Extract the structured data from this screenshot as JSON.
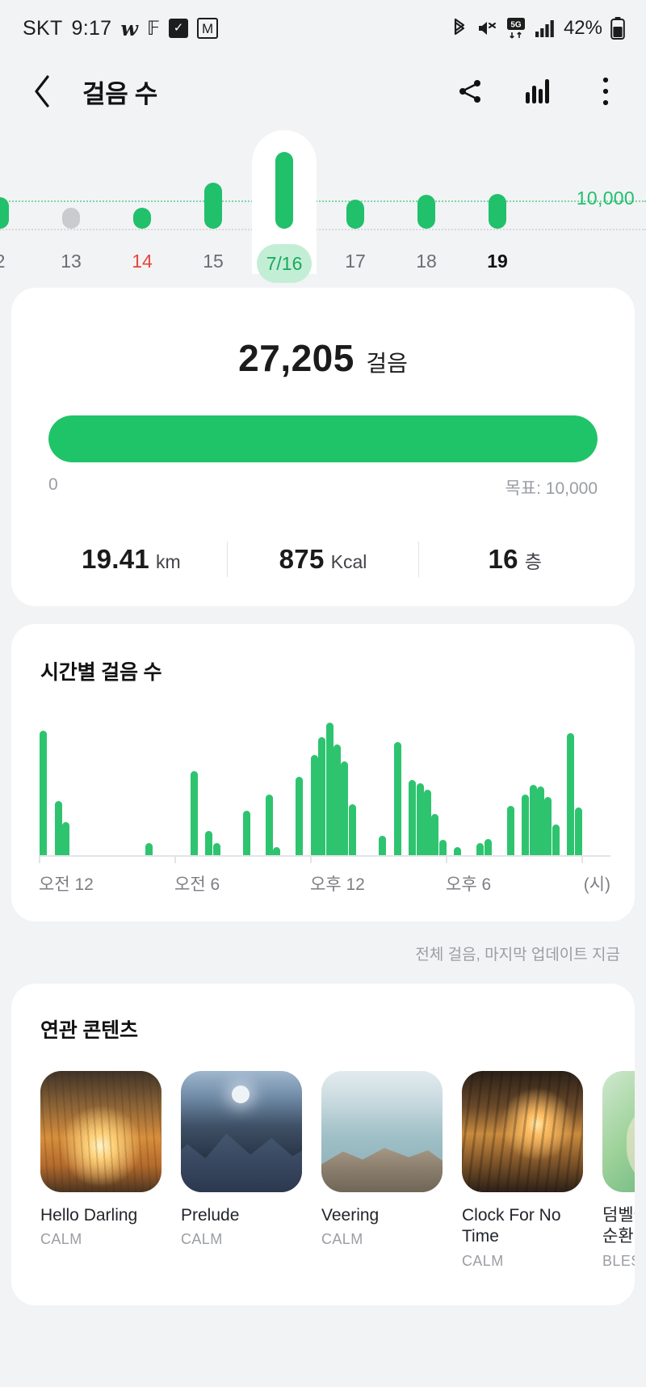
{
  "status_bar": {
    "carrier": "SKT",
    "time": "9:17",
    "app_icons": [
      "w-app-icon",
      "x-app-icon",
      "checkbox-app-icon",
      "m-app-icon"
    ],
    "right_icons": [
      "bluetooth-icon",
      "mute-icon",
      "5g-icon",
      "signal-icon"
    ],
    "battery_percent": "42%"
  },
  "header": {
    "title": "걸음 수",
    "back_icon": "back-chevron-icon",
    "share_icon": "share-icon",
    "chart_icon": "bar-chart-icon",
    "more_icon": "more-vertical-icon"
  },
  "day_strip": {
    "goal_label": "10,000",
    "selected_day": "7/16",
    "days": [
      {
        "label": "2",
        "value": 11200,
        "state": "normal"
      },
      {
        "label": "13",
        "value": 2600,
        "state": "inactive"
      },
      {
        "label": "14",
        "value": 6800,
        "state": "weekend"
      },
      {
        "label": "15",
        "value": 16200,
        "state": "normal"
      },
      {
        "label": "7/16",
        "value": 27205,
        "state": "selected"
      },
      {
        "label": "17",
        "value": 10300,
        "state": "normal"
      },
      {
        "label": "18",
        "value": 12000,
        "state": "normal"
      },
      {
        "label": "19",
        "value": 12300,
        "state": "today"
      }
    ]
  },
  "summary": {
    "steps": "27,205",
    "steps_unit": "걸음",
    "progress_percent": 100,
    "progress_min_label": "0",
    "progress_goal_label": "목표: 10,000",
    "stats": [
      {
        "value": "19.41",
        "unit": "km"
      },
      {
        "value": "875",
        "unit": "Kcal"
      },
      {
        "value": "16",
        "unit": "층"
      }
    ]
  },
  "hourly": {
    "title": "시간별 걸음 수",
    "footer": "전체 걸음, 마지막 업데이트 지금"
  },
  "chart_data": {
    "type": "bar",
    "title": "시간별 걸음 수",
    "xlabel": "(시)",
    "ylabel": "",
    "grid": false,
    "axis_labels": [
      "오전 12",
      "오전 6",
      "오후 12",
      "오후 6",
      "(시)"
    ],
    "axis_label_positions": [
      0,
      6,
      12,
      18,
      24
    ],
    "categories": [
      "0:00",
      "0:20",
      "0:40",
      "1:00",
      "1:20",
      "1:40",
      "2:00",
      "2:20",
      "2:40",
      "3:00",
      "3:20",
      "3:40",
      "4:00",
      "4:20",
      "4:40",
      "5:00",
      "5:20",
      "5:40",
      "6:00",
      "6:20",
      "6:40",
      "7:00",
      "7:20",
      "7:40",
      "8:00",
      "8:20",
      "8:40",
      "9:00",
      "9:20",
      "9:40",
      "10:00",
      "10:20",
      "10:40",
      "11:00",
      "11:20",
      "11:40",
      "12:00",
      "12:20",
      "12:40",
      "13:00",
      "13:20",
      "13:40",
      "14:00",
      "14:20",
      "14:40",
      "15:00",
      "15:20",
      "15:40",
      "16:00",
      "16:20",
      "16:40",
      "17:00",
      "17:20",
      "17:40",
      "18:00",
      "18:20",
      "18:40",
      "19:00",
      "19:20",
      "19:40",
      "20:00",
      "20:20",
      "20:40",
      "21:00",
      "21:20",
      "21:40",
      "22:00",
      "22:20",
      "22:40",
      "23:00",
      "23:20",
      "23:40"
    ],
    "values": [
      1560,
      0,
      680,
      420,
      0,
      0,
      0,
      0,
      0,
      0,
      0,
      0,
      0,
      0,
      150,
      0,
      0,
      0,
      0,
      0,
      1050,
      0,
      300,
      150,
      0,
      0,
      0,
      560,
      0,
      0,
      760,
      100,
      0,
      0,
      980,
      0,
      1250,
      1480,
      1660,
      1390,
      1170,
      640,
      0,
      0,
      0,
      240,
      0,
      1420,
      0,
      940,
      900,
      820,
      520,
      190,
      0,
      100,
      0,
      0,
      150,
      200,
      0,
      0,
      620,
      0,
      760,
      880,
      860,
      730,
      380,
      0,
      1530,
      600
    ],
    "ylim": [
      0,
      1700
    ],
    "bar_color": "#2ec46f"
  },
  "related": {
    "title": "연관 콘텐츠",
    "items": [
      {
        "name": "Hello Darling",
        "brand": "CALM",
        "art": "art-sunset"
      },
      {
        "name": "Prelude",
        "brand": "CALM",
        "art": "art-mountain"
      },
      {
        "name": "Veering",
        "brand": "CALM",
        "art": "art-cliff"
      },
      {
        "name": "Clock For No Time",
        "brand": "CALM",
        "art": "art-winter"
      },
      {
        "name": "덤벨을\n순환 트",
        "brand": "BLESS",
        "art": "art-green"
      }
    ]
  }
}
